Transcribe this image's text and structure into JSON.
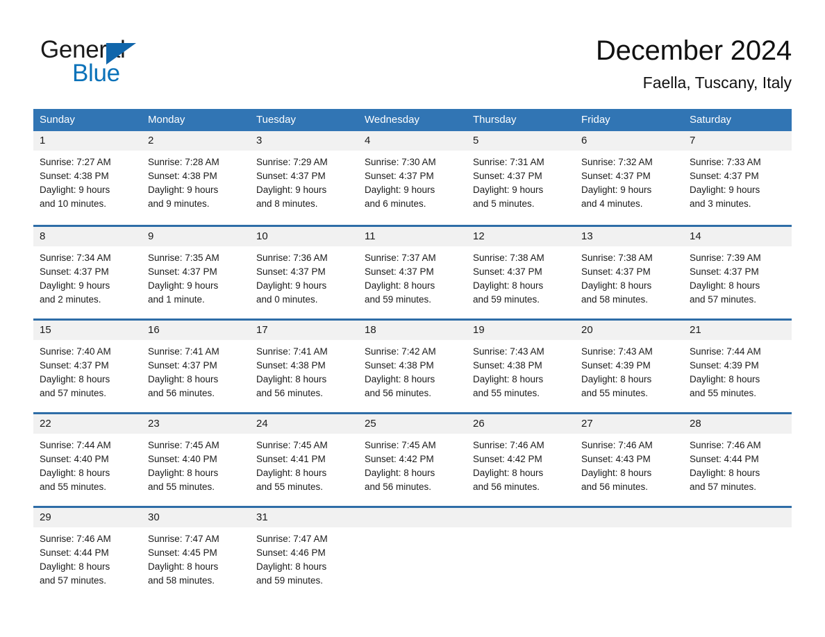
{
  "logo": {
    "text_top": "General",
    "text_bottom": "Blue",
    "triangle_icon": "triangle-right-icon",
    "accent_color": "#0b72b9"
  },
  "header": {
    "title": "December 2024",
    "location": "Faella, Tuscany, Italy"
  },
  "colors": {
    "header_blue": "#3175b4",
    "row_divider_blue": "#2e6da7",
    "day_band_gray": "#f1f1f1",
    "logo_blue": "#0b72b9"
  },
  "weekdays": [
    "Sunday",
    "Monday",
    "Tuesday",
    "Wednesday",
    "Thursday",
    "Friday",
    "Saturday"
  ],
  "weeks": [
    [
      {
        "day": "1",
        "sunrise": "Sunrise: 7:27 AM",
        "sunset": "Sunset: 4:38 PM",
        "daylight_line1": "Daylight: 9 hours",
        "daylight_line2": "and 10 minutes."
      },
      {
        "day": "2",
        "sunrise": "Sunrise: 7:28 AM",
        "sunset": "Sunset: 4:38 PM",
        "daylight_line1": "Daylight: 9 hours",
        "daylight_line2": "and 9 minutes."
      },
      {
        "day": "3",
        "sunrise": "Sunrise: 7:29 AM",
        "sunset": "Sunset: 4:37 PM",
        "daylight_line1": "Daylight: 9 hours",
        "daylight_line2": "and 8 minutes."
      },
      {
        "day": "4",
        "sunrise": "Sunrise: 7:30 AM",
        "sunset": "Sunset: 4:37 PM",
        "daylight_line1": "Daylight: 9 hours",
        "daylight_line2": "and 6 minutes."
      },
      {
        "day": "5",
        "sunrise": "Sunrise: 7:31 AM",
        "sunset": "Sunset: 4:37 PM",
        "daylight_line1": "Daylight: 9 hours",
        "daylight_line2": "and 5 minutes."
      },
      {
        "day": "6",
        "sunrise": "Sunrise: 7:32 AM",
        "sunset": "Sunset: 4:37 PM",
        "daylight_line1": "Daylight: 9 hours",
        "daylight_line2": "and 4 minutes."
      },
      {
        "day": "7",
        "sunrise": "Sunrise: 7:33 AM",
        "sunset": "Sunset: 4:37 PM",
        "daylight_line1": "Daylight: 9 hours",
        "daylight_line2": "and 3 minutes."
      }
    ],
    [
      {
        "day": "8",
        "sunrise": "Sunrise: 7:34 AM",
        "sunset": "Sunset: 4:37 PM",
        "daylight_line1": "Daylight: 9 hours",
        "daylight_line2": "and 2 minutes."
      },
      {
        "day": "9",
        "sunrise": "Sunrise: 7:35 AM",
        "sunset": "Sunset: 4:37 PM",
        "daylight_line1": "Daylight: 9 hours",
        "daylight_line2": "and 1 minute."
      },
      {
        "day": "10",
        "sunrise": "Sunrise: 7:36 AM",
        "sunset": "Sunset: 4:37 PM",
        "daylight_line1": "Daylight: 9 hours",
        "daylight_line2": "and 0 minutes."
      },
      {
        "day": "11",
        "sunrise": "Sunrise: 7:37 AM",
        "sunset": "Sunset: 4:37 PM",
        "daylight_line1": "Daylight: 8 hours",
        "daylight_line2": "and 59 minutes."
      },
      {
        "day": "12",
        "sunrise": "Sunrise: 7:38 AM",
        "sunset": "Sunset: 4:37 PM",
        "daylight_line1": "Daylight: 8 hours",
        "daylight_line2": "and 59 minutes."
      },
      {
        "day": "13",
        "sunrise": "Sunrise: 7:38 AM",
        "sunset": "Sunset: 4:37 PM",
        "daylight_line1": "Daylight: 8 hours",
        "daylight_line2": "and 58 minutes."
      },
      {
        "day": "14",
        "sunrise": "Sunrise: 7:39 AM",
        "sunset": "Sunset: 4:37 PM",
        "daylight_line1": "Daylight: 8 hours",
        "daylight_line2": "and 57 minutes."
      }
    ],
    [
      {
        "day": "15",
        "sunrise": "Sunrise: 7:40 AM",
        "sunset": "Sunset: 4:37 PM",
        "daylight_line1": "Daylight: 8 hours",
        "daylight_line2": "and 57 minutes."
      },
      {
        "day": "16",
        "sunrise": "Sunrise: 7:41 AM",
        "sunset": "Sunset: 4:37 PM",
        "daylight_line1": "Daylight: 8 hours",
        "daylight_line2": "and 56 minutes."
      },
      {
        "day": "17",
        "sunrise": "Sunrise: 7:41 AM",
        "sunset": "Sunset: 4:38 PM",
        "daylight_line1": "Daylight: 8 hours",
        "daylight_line2": "and 56 minutes."
      },
      {
        "day": "18",
        "sunrise": "Sunrise: 7:42 AM",
        "sunset": "Sunset: 4:38 PM",
        "daylight_line1": "Daylight: 8 hours",
        "daylight_line2": "and 56 minutes."
      },
      {
        "day": "19",
        "sunrise": "Sunrise: 7:43 AM",
        "sunset": "Sunset: 4:38 PM",
        "daylight_line1": "Daylight: 8 hours",
        "daylight_line2": "and 55 minutes."
      },
      {
        "day": "20",
        "sunrise": "Sunrise: 7:43 AM",
        "sunset": "Sunset: 4:39 PM",
        "daylight_line1": "Daylight: 8 hours",
        "daylight_line2": "and 55 minutes."
      },
      {
        "day": "21",
        "sunrise": "Sunrise: 7:44 AM",
        "sunset": "Sunset: 4:39 PM",
        "daylight_line1": "Daylight: 8 hours",
        "daylight_line2": "and 55 minutes."
      }
    ],
    [
      {
        "day": "22",
        "sunrise": "Sunrise: 7:44 AM",
        "sunset": "Sunset: 4:40 PM",
        "daylight_line1": "Daylight: 8 hours",
        "daylight_line2": "and 55 minutes."
      },
      {
        "day": "23",
        "sunrise": "Sunrise: 7:45 AM",
        "sunset": "Sunset: 4:40 PM",
        "daylight_line1": "Daylight: 8 hours",
        "daylight_line2": "and 55 minutes."
      },
      {
        "day": "24",
        "sunrise": "Sunrise: 7:45 AM",
        "sunset": "Sunset: 4:41 PM",
        "daylight_line1": "Daylight: 8 hours",
        "daylight_line2": "and 55 minutes."
      },
      {
        "day": "25",
        "sunrise": "Sunrise: 7:45 AM",
        "sunset": "Sunset: 4:42 PM",
        "daylight_line1": "Daylight: 8 hours",
        "daylight_line2": "and 56 minutes."
      },
      {
        "day": "26",
        "sunrise": "Sunrise: 7:46 AM",
        "sunset": "Sunset: 4:42 PM",
        "daylight_line1": "Daylight: 8 hours",
        "daylight_line2": "and 56 minutes."
      },
      {
        "day": "27",
        "sunrise": "Sunrise: 7:46 AM",
        "sunset": "Sunset: 4:43 PM",
        "daylight_line1": "Daylight: 8 hours",
        "daylight_line2": "and 56 minutes."
      },
      {
        "day": "28",
        "sunrise": "Sunrise: 7:46 AM",
        "sunset": "Sunset: 4:44 PM",
        "daylight_line1": "Daylight: 8 hours",
        "daylight_line2": "and 57 minutes."
      }
    ],
    [
      {
        "day": "29",
        "sunrise": "Sunrise: 7:46 AM",
        "sunset": "Sunset: 4:44 PM",
        "daylight_line1": "Daylight: 8 hours",
        "daylight_line2": "and 57 minutes."
      },
      {
        "day": "30",
        "sunrise": "Sunrise: 7:47 AM",
        "sunset": "Sunset: 4:45 PM",
        "daylight_line1": "Daylight: 8 hours",
        "daylight_line2": "and 58 minutes."
      },
      {
        "day": "31",
        "sunrise": "Sunrise: 7:47 AM",
        "sunset": "Sunset: 4:46 PM",
        "daylight_line1": "Daylight: 8 hours",
        "daylight_line2": "and 59 minutes."
      },
      {
        "day": "",
        "sunrise": "",
        "sunset": "",
        "daylight_line1": "",
        "daylight_line2": ""
      },
      {
        "day": "",
        "sunrise": "",
        "sunset": "",
        "daylight_line1": "",
        "daylight_line2": ""
      },
      {
        "day": "",
        "sunrise": "",
        "sunset": "",
        "daylight_line1": "",
        "daylight_line2": ""
      },
      {
        "day": "",
        "sunrise": "",
        "sunset": "",
        "daylight_line1": "",
        "daylight_line2": ""
      }
    ]
  ]
}
